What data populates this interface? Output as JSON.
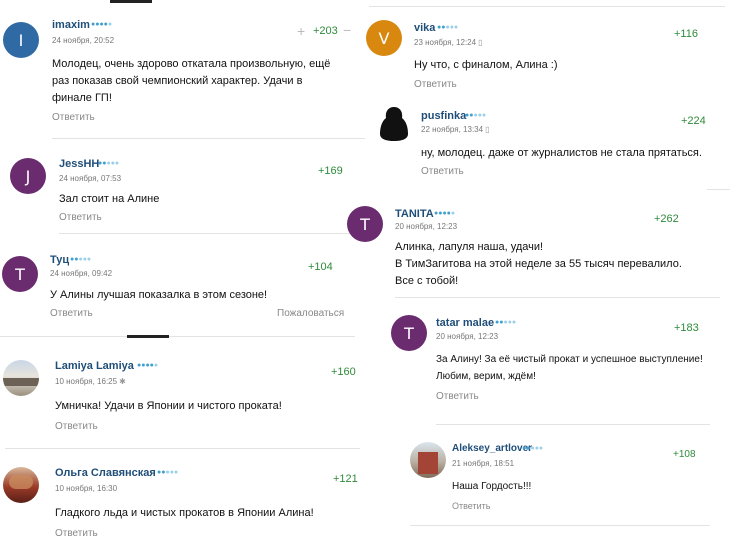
{
  "left": [
    {
      "author": "imaxim",
      "avatar_letter": "I",
      "avatar_color": "#2f6aa5",
      "date": "24 ноября, 20:52",
      "device": "apple-icon",
      "score": "+203",
      "rating": 4,
      "text_lines": [
        "Молодец, очень здорово откатала произвольную, ещё",
        "раз показав свой чемпионский характер. Удачи в",
        "финале ГП!"
      ],
      "reply": "Ответить"
    },
    {
      "author": "JessHH",
      "avatar_letter": "J",
      "avatar_color": "#6a2c6f",
      "date": "24 ноября, 07:53",
      "score": "+169",
      "rating": 2,
      "text_lines": [
        "Зал стоит на Алине"
      ],
      "reply": "Ответить"
    },
    {
      "author": "Туц",
      "avatar_letter": "T",
      "avatar_color": "#6a2c6f",
      "date": "24 ноября, 09:42",
      "score": "+104",
      "rating": 2,
      "text_lines": [
        "У Алины лучшая показалка в этом сезоне!"
      ],
      "reply": "Ответить",
      "complain": "Пожаловаться"
    },
    {
      "author": "Lamiya Lamiya",
      "date": "10 ноября, 16:25",
      "device": "android-icon",
      "score": "+160",
      "rating": 4,
      "text_lines": [
        "Умничка! Удачи в Японии и чистого проката!"
      ],
      "reply": "Ответить"
    },
    {
      "author": "Ольга Славянская",
      "date": "10 ноября, 16:30",
      "device": "apple-icon",
      "score": "+121",
      "rating": 2,
      "text_lines": [
        "Гладкого льда и чистых прокатов в Японии Алина!"
      ],
      "reply": "Ответить"
    }
  ],
  "right": [
    {
      "author": "vika",
      "avatar_letter": "V",
      "avatar_color": "#d9880f",
      "date": "23 ноября, 12:24",
      "device": "phone-icon",
      "score": "+116",
      "rating": 2,
      "text_lines": [
        "Ну что, с финалом, Алина :)"
      ],
      "reply": "Ответить"
    },
    {
      "author": "pusfinka",
      "date": "22 ноября, 13:34",
      "device": "phone-icon",
      "score": "+224",
      "rating": 2,
      "text_lines": [
        "ну, молодец. даже от журналистов не стала прятаться."
      ],
      "reply": "Ответить"
    },
    {
      "author": "TANITA",
      "avatar_letter": "T",
      "avatar_color": "#6a2c6f",
      "date": "20 ноября, 12:23",
      "score": "+262",
      "rating": 4,
      "text_lines": [
        "Алинка, лапуля наша, удачи!",
        "В ТимЗагитова на этой неделе за 55 тысяч перевалило.",
        "Все с тобой!"
      ],
      "reply": "Ответить"
    },
    {
      "author": "tatar malae",
      "avatar_letter": "T",
      "avatar_color": "#6a2c6f",
      "date": "20 ноября, 12:23",
      "device": "apple-icon",
      "score": "+183",
      "rating": 2,
      "text_lines": [
        "За Алину! За её чистый прокат и успешное выступление!",
        "Любим, верим, ждём!"
      ],
      "reply": "Ответить"
    },
    {
      "author": "Aleksey_artlover",
      "date": "21 ноября, 18:51",
      "device": "apple-icon",
      "score": "+108",
      "rating": 2,
      "text_lines": [
        "Наша Гордость!!!"
      ],
      "reply": "Ответить"
    }
  ]
}
